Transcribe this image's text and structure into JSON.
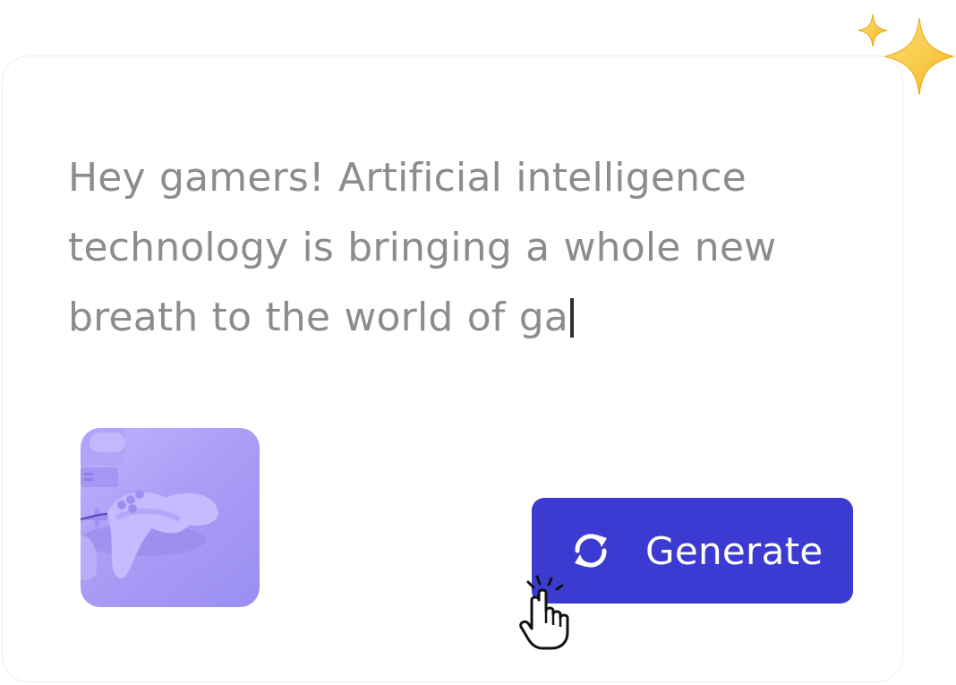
{
  "prompt": {
    "text": "Hey gamers! Artificial intelligence technology is bringing a whole new breath to the world of ga"
  },
  "thumbnail": {
    "icon": "game-controller-image"
  },
  "generate_button": {
    "label": "Generate",
    "icon": "refresh-icon",
    "color": "#3c3bd1"
  },
  "decorations": {
    "sparkles_icon": "sparkles-icon",
    "cursor_icon": "hand-pointer-icon"
  },
  "colors": {
    "text": "#8c8c8e",
    "accent": "#3c3bd1",
    "thumbnail": "#ab9df6",
    "sparkle": "#f6c934"
  }
}
